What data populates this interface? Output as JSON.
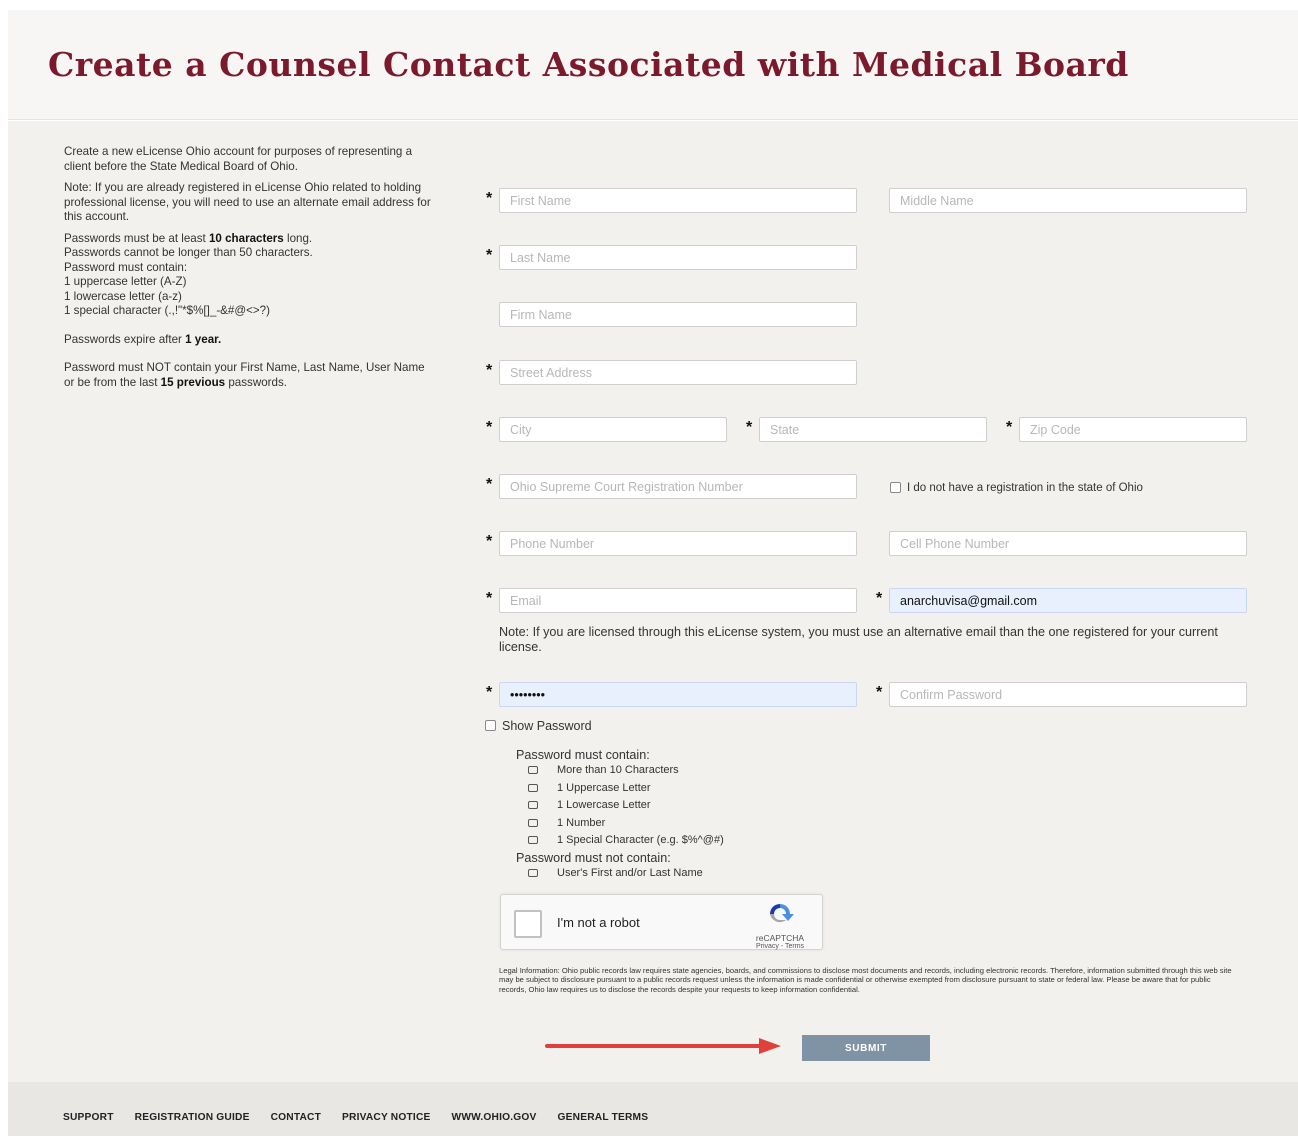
{
  "page_title": "Create a Counsel Contact Associated with Medical Board",
  "info": {
    "intro": "Create a new eLicense Ohio account for purposes of representing a client before the State Medical Board of Ohio.",
    "note": "Note: If you are already registered in eLicense Ohio related to holding professional license, you will need to use an alternate email address for this account.",
    "pw_len_a": "Passwords must be at least ",
    "pw_len_b": "10 characters",
    "pw_len_c": " long.",
    "pw_max": "Passwords cannot be longer than 50 characters.",
    "pw_contain": "Password must contain:",
    "pw_upper": "1 uppercase letter (A-Z)",
    "pw_lower": "1 lowercase letter (a-z)",
    "pw_special": "1 special character (.,!\"*$%[]_-&#@<>?)",
    "pw_expire_a": "Passwords expire after ",
    "pw_expire_b": "1 year.",
    "pw_not_a": "Password must NOT contain your First Name, Last Name, User Name or be from the last ",
    "pw_not_b": "15 previous",
    "pw_not_c": " passwords."
  },
  "form": {
    "first_name": "First Name",
    "middle_name": "Middle Name",
    "last_name": "Last Name",
    "firm_name": "Firm Name",
    "street_address": "Street Address",
    "city": "City",
    "state": "State",
    "zip_code": "Zip Code",
    "registration_number": "Ohio Supreme Court Registration Number",
    "no_registration_label": "I do not have a registration in the state of Ohio",
    "phone_number": "Phone Number",
    "cell_phone_number": "Cell Phone Number",
    "email": "Email",
    "confirm_email_value": "anarchuvisa@gmail.com",
    "email_note": "Note: If you are licensed through this eLicense system, you must use an alternative email than the one registered for your current license.",
    "password_value": "••••••••",
    "confirm_password": "Confirm Password",
    "show_password_label": "Show Password",
    "required_mark": "*"
  },
  "password_rules": {
    "must_contain_title": "Password must contain:",
    "must_contain": [
      "More than 10 Characters",
      "1 Uppercase Letter",
      "1 Lowercase Letter",
      "1 Number",
      "1 Special Character (e.g. $%^@#)"
    ],
    "must_not_contain_title": "Password must not contain:",
    "must_not_contain": [
      "User's First and/or Last Name"
    ]
  },
  "captcha": {
    "label": "I'm not a robot",
    "brand": "reCAPTCHA",
    "links": "Privacy - Terms"
  },
  "legal_text": "Legal Information: Ohio public records law requires state agencies, boards, and commissions to disclose most documents and records, including electronic records. Therefore, information submitted through this web site may be subject to disclosure pursuant to a public records request unless the information is made confidential or otherwise exempted from disclosure pursuant to state or federal law. Please be aware that for public records, Ohio law requires us to disclose the records despite your requests to keep information confidential.",
  "submit_label": "SUBMIT",
  "footer": {
    "links": [
      "SUPPORT",
      "REGISTRATION GUIDE",
      "CONTACT",
      "PRIVACY NOTICE",
      "WWW.OHIO.GOV",
      "GENERAL TERMS"
    ]
  },
  "colors": {
    "title": "#7a1a2c",
    "submit_bg": "#7f93a4",
    "arrow": "#e0403a",
    "autofill_bg": "#e8f0fe"
  }
}
